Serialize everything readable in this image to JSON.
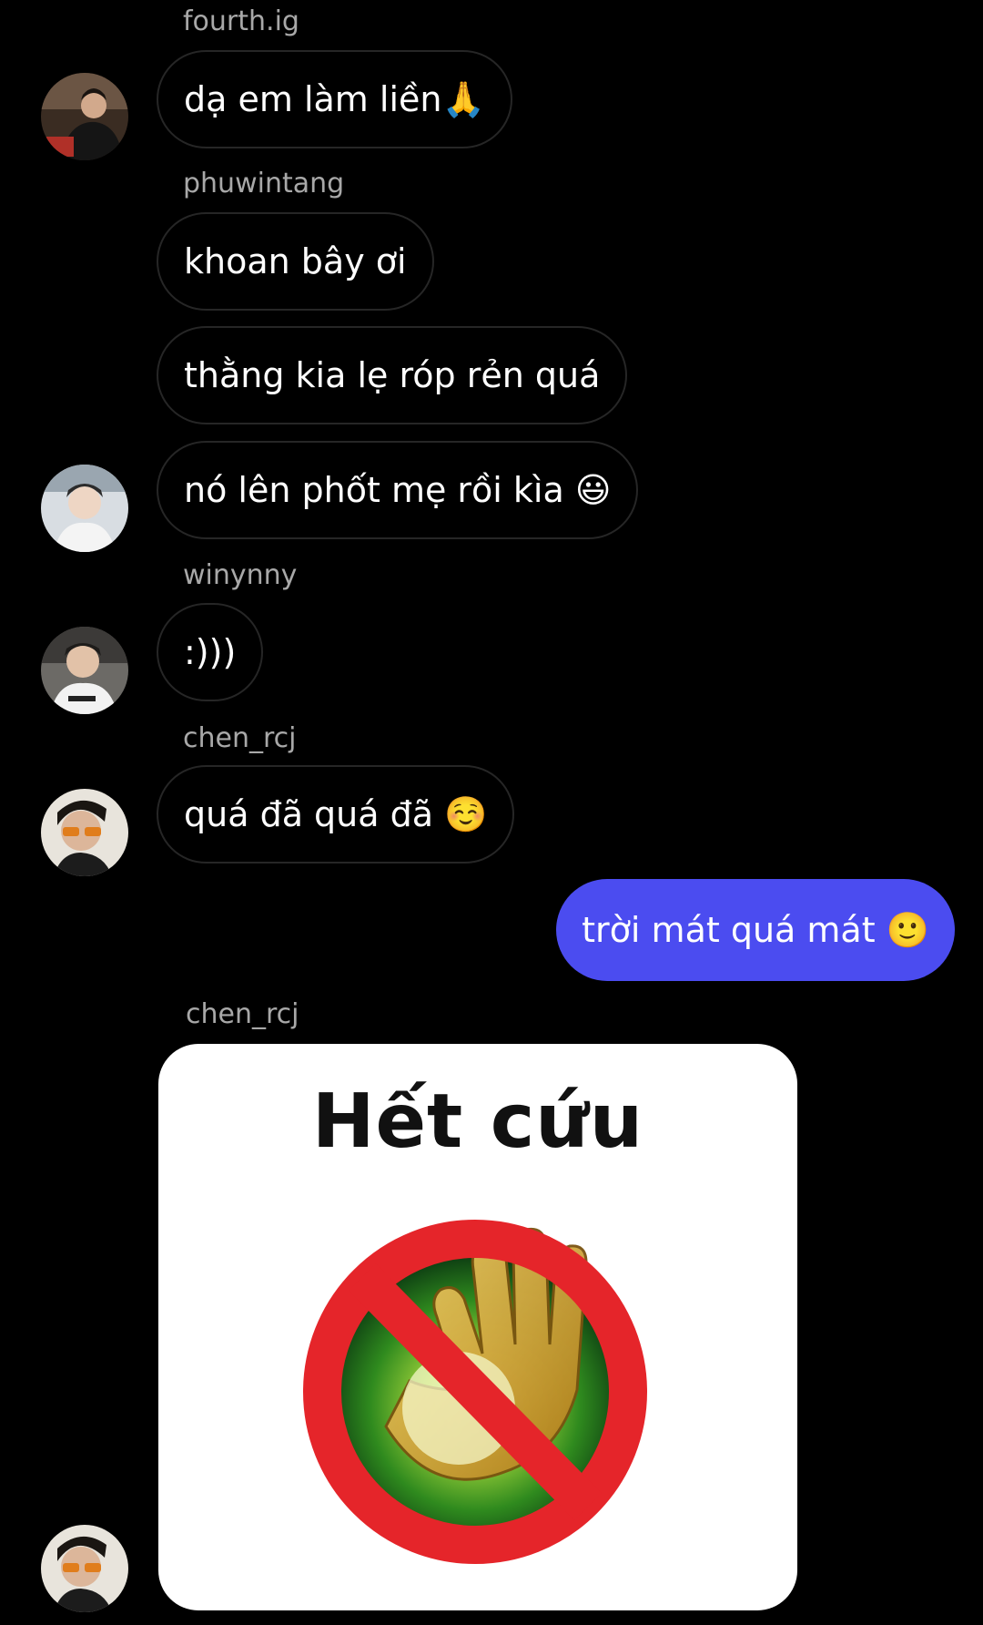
{
  "colors": {
    "background": "#000000",
    "bubble_border": "#262626",
    "own_bubble": "#4b4cf0",
    "username": "#a8a8a8",
    "prohibited_red": "#e5252a"
  },
  "messages": [
    {
      "username": "fourth.ig",
      "text": "dạ em làm liền🙏",
      "avatar_icon": "user-avatar"
    },
    {
      "username": "phuwintang",
      "text": "khoan bây ơi"
    },
    {
      "text": "thằng kia lẹ róp rẻn quá"
    },
    {
      "text": "nó lên phốt mẹ rồi kìa 😃",
      "avatar_icon": "user-avatar"
    },
    {
      "username": "winynny",
      "text": ":)))",
      "avatar_icon": "user-avatar"
    },
    {
      "username": "chen_rcj",
      "text": "quá đã quá đã ☺️",
      "avatar_icon": "user-avatar"
    },
    {
      "text": "trời mát quá mát 🙂",
      "own": true
    },
    {
      "username": "chen_rcj",
      "image": {
        "caption": "Hết cứu",
        "icon": "no-healing-icon"
      },
      "avatar_icon": "user-avatar"
    }
  ]
}
